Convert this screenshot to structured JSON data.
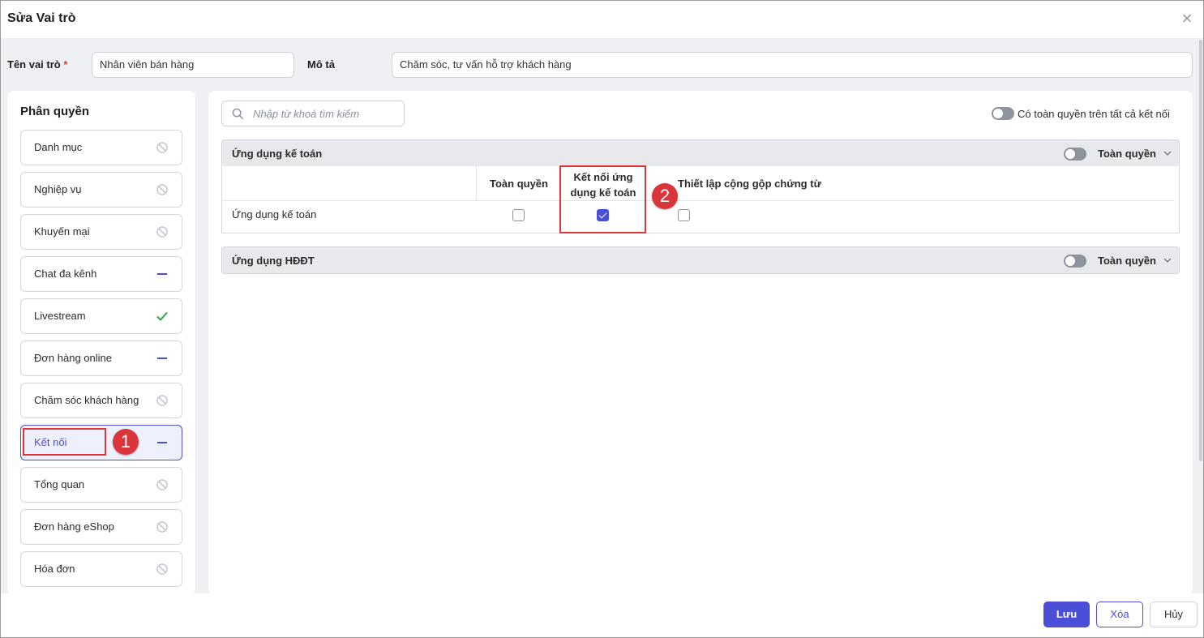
{
  "dialog": {
    "title": "Sửa Vai trò"
  },
  "form": {
    "role_name_label": "Tên vai trò",
    "required_mark": "*",
    "role_name_value": "Nhân viên bán hàng",
    "description_label": "Mô tả",
    "description_value": "Chăm sóc, tư vấn hỗ trợ khách hàng"
  },
  "sidebar": {
    "title": "Phân quyền",
    "items": [
      {
        "label": "Danh mục",
        "status": "none-icon"
      },
      {
        "label": "Nghiệp vụ",
        "status": "none-icon"
      },
      {
        "label": "Khuyến mại",
        "status": "none-icon"
      },
      {
        "label": "Chat đa kênh",
        "status": "partial-icon"
      },
      {
        "label": "Livestream",
        "status": "check-icon"
      },
      {
        "label": "Đơn hàng online",
        "status": "partial-icon"
      },
      {
        "label": "Chăm sóc khách hàng",
        "status": "none-icon"
      },
      {
        "label": "Kết nối",
        "status": "partial-icon"
      },
      {
        "label": "Tổng quan",
        "status": "none-icon"
      },
      {
        "label": "Đơn hàng eShop",
        "status": "none-icon"
      },
      {
        "label": "Hóa đơn",
        "status": "none-icon"
      }
    ]
  },
  "main": {
    "search_placeholder": "Nhập từ khoá tìm kiếm",
    "global_toggle_label": "Có toàn quyền trên tất cả kết nối",
    "groups": [
      {
        "title": "Ứng dụng kế toán",
        "full_label": "Toàn quyền",
        "columns": [
          "Toàn quyền",
          "Kết nối ứng dụng kế toán",
          "Thiết lập cộng gộp chứng từ"
        ],
        "rows": [
          {
            "label": "Ứng dụng kế toán",
            "checks": [
              false,
              true,
              false
            ]
          }
        ]
      },
      {
        "title": "Ứng dụng HĐĐT",
        "full_label": "Toàn quyền"
      }
    ]
  },
  "annotations": {
    "badge1": "1",
    "badge2": "2"
  },
  "footer": {
    "save": "Lưu",
    "delete": "Xóa",
    "cancel": "Hủy"
  },
  "colors": {
    "accent": "#4b4fd8",
    "highlight": "#e0363b",
    "check": "#3aa34a"
  }
}
